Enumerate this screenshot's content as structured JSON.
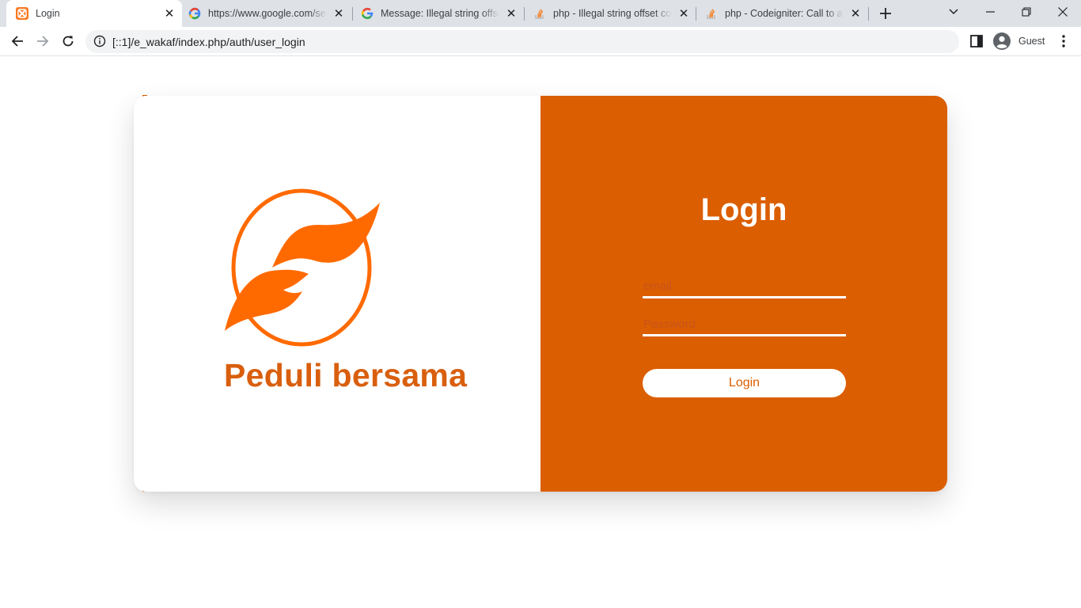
{
  "browser": {
    "tabs": [
      {
        "title": "Login",
        "icon": "xampp-icon"
      },
      {
        "title": "https://www.google.com/search",
        "icon": "google-icon"
      },
      {
        "title": "Message: Illegal string offset",
        "icon": "google-icon"
      },
      {
        "title": "php - Illegal string offset code",
        "icon": "stackoverflow-icon"
      },
      {
        "title": "php - Codeigniter: Call to a member",
        "icon": "stackoverflow-icon"
      }
    ],
    "address_bar": {
      "url": "[::1]/e_wakaf/index.php/auth/user_login"
    },
    "profile": {
      "label": "Guest"
    }
  },
  "page": {
    "brand_name": "Peduli bersama",
    "login_title": "Login",
    "email_field": {
      "placeholder": "email",
      "value": ""
    },
    "password_field": {
      "placeholder": "Password",
      "value": ""
    },
    "submit_label": "Login"
  },
  "colors": {
    "accent": "#db5e00",
    "logo_orange": "#ff6a00",
    "brand_text": "#d95f0e",
    "tabstrip_bg": "#dee1e6",
    "white": "#ffffff"
  }
}
